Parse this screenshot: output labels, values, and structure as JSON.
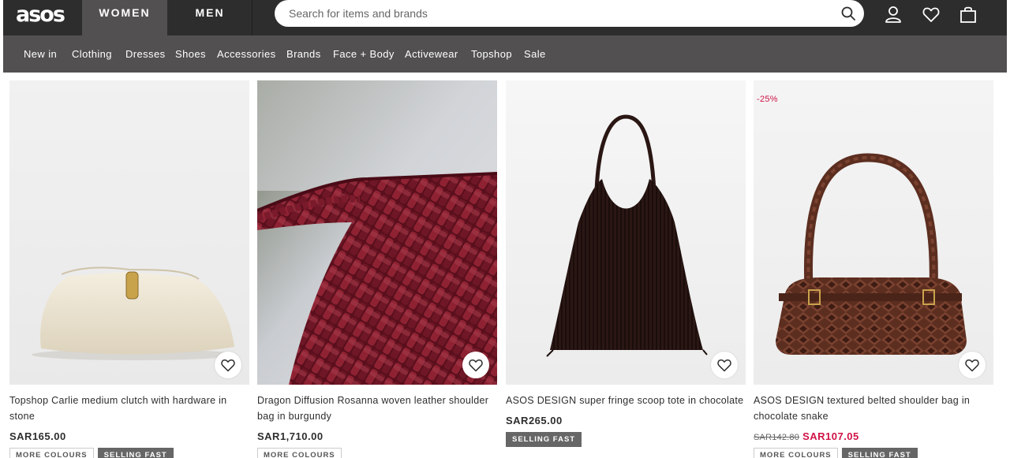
{
  "header": {
    "logo": "asos",
    "tabs": [
      "WOMEN",
      "MEN"
    ],
    "search_placeholder": "Search for items and brands",
    "icons": [
      "search-icon",
      "account-icon",
      "heart-icon",
      "bag-icon"
    ]
  },
  "categories": [
    "New in",
    "Clothing",
    "Dresses",
    "Shoes",
    "Accessories",
    "Brands",
    "Face + Body",
    "Activewear",
    "Topshop",
    "Sale"
  ],
  "colors": {
    "header_bg": "#2d2d2d",
    "nav_bg": "#525050",
    "sale_red": "#d01345",
    "badge_grey": "#666666"
  },
  "products": [
    {
      "title": "Topshop Carlie medium clutch with hardware in stone",
      "price": "SAR165.00",
      "badges": [
        "MORE COLOURS",
        "SELLING FAST"
      ]
    },
    {
      "title": "Dragon Diffusion Rosanna woven leather shoulder bag in burgundy",
      "price": "SAR1,710.00",
      "badges": [
        "MORE COLOURS"
      ]
    },
    {
      "title": "ASOS DESIGN super fringe scoop tote in chocolate",
      "price": "SAR265.00",
      "badges": [
        "SELLING FAST"
      ]
    },
    {
      "title": "ASOS DESIGN textured belted shoulder bag in chocolate snake",
      "discount": "-25%",
      "old_price": "SAR142.80",
      "sale_price": "SAR107.05",
      "badges": [
        "MORE COLOURS",
        "SELLING FAST"
      ]
    }
  ]
}
